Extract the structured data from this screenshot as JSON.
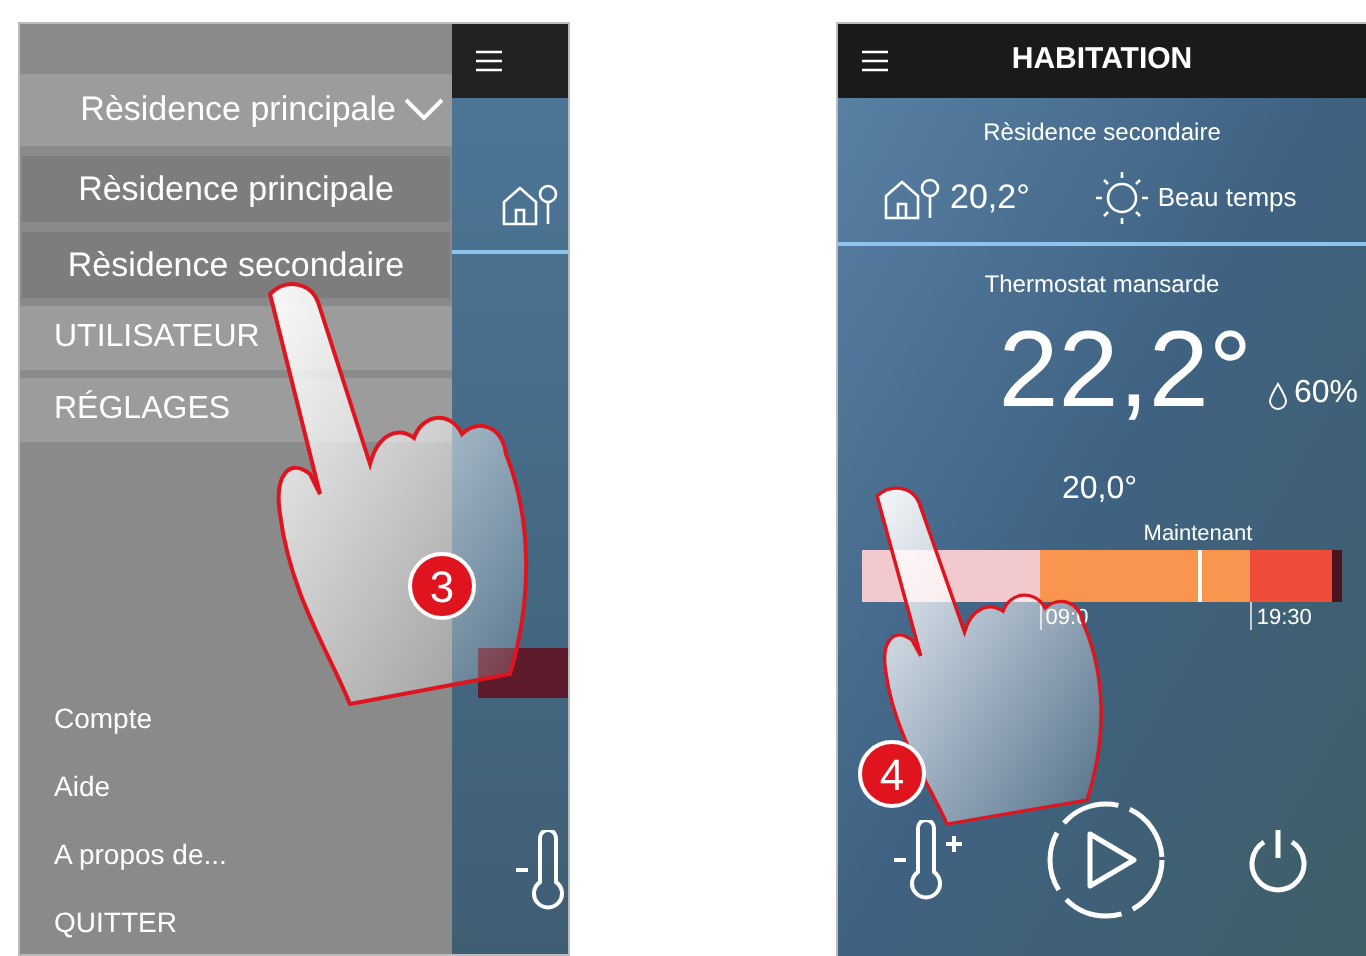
{
  "left_screen": {
    "menu": {
      "dropdown": {
        "value": "Rèsidence principale",
        "expanded": true
      },
      "options": [
        "Rèsidence principale",
        "Rèsidence secondaire"
      ],
      "sections": [
        "UTILISATEUR",
        "RÉGLAGES"
      ],
      "footer_items": [
        "Compte",
        "Aide",
        "A propos de...",
        "QUITTER"
      ]
    },
    "step_badge": "3"
  },
  "right_screen": {
    "header": {
      "title": "HABITATION"
    },
    "location": "Rèsidence secondaire",
    "outdoor_temperature": "20,2°",
    "weather": "Beau temps",
    "thermostat": {
      "name": "Thermostat mansarde",
      "temperature": "22,2°",
      "humidity": "60%",
      "setpoint": "20,0°"
    },
    "schedule": {
      "now_label": "Maintenant",
      "segments": [
        {
          "color": "#f2c9cc"
        },
        {
          "color": "#fa9550"
        },
        {
          "color": "#f04c3a"
        },
        {
          "color": "#4a1420"
        }
      ],
      "times": [
        "09:0",
        "19:30"
      ]
    },
    "step_badge": "4"
  }
}
